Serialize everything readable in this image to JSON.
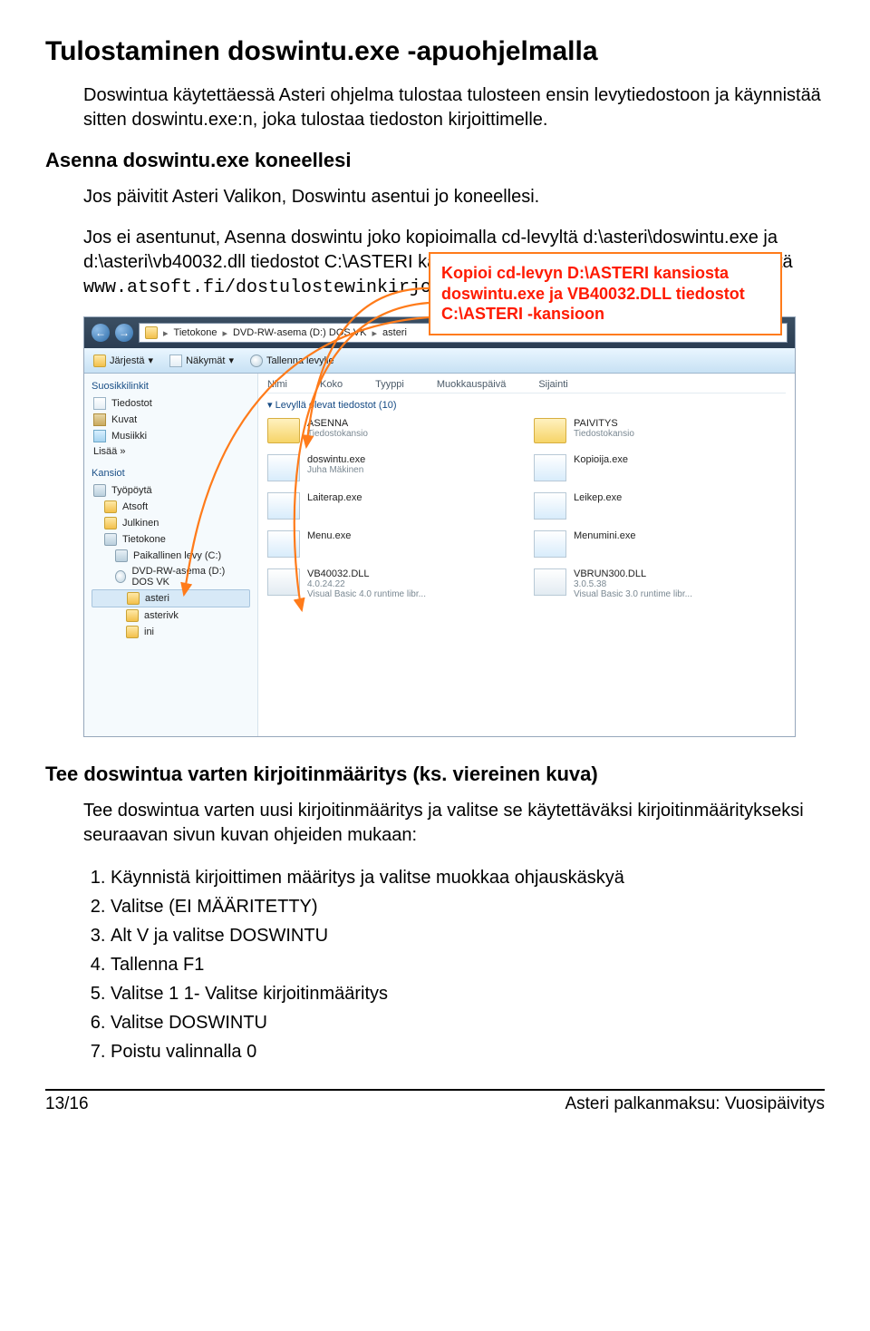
{
  "title": "Tulostaminen doswintu.exe -apuohjelmalla",
  "para1": "Doswintua käytettäessä Asteri ohjelma tulostaa tulosteen ensin levytiedostoon ja käynnistää sitten doswintu.exe:n, joka tulostaa tiedoston kirjoittimelle.",
  "h2": "Asenna doswintu.exe koneellesi",
  "para2": "Jos päivitit Asteri Valikon, Doswintu asentui jo koneellesi.",
  "para3a": "Jos ei asentunut, Asenna doswintu joko kopioimalla cd-levyltä d:\\asteri\\doswintu.exe ja d:\\asteri\\vb40032.dll tiedostot C:\\ASTERI kansioon tai tallenna vastaava tiedostot netistä ",
  "para3b": "www.atsoft.fi/dostulostewinkirjoittimelle.htm",
  "callout": "Kopioi cd-levyn D:\\ASTERI kansiosta doswintu.exe ja VB40032.DLL tiedostot C:\\ASTERI -kansioon",
  "breadcrumb": {
    "a": "Tietokone",
    "b": "DVD-RW-asema (D:) DOS VK",
    "c": "asteri"
  },
  "toolbar": {
    "a": "Järjestä",
    "b": "Näkymät",
    "c": "Tallenna levylle"
  },
  "sidebar": {
    "favhead": "Suosikkilinkit",
    "fav": [
      "Tiedostot",
      "Kuvat",
      "Musiikki",
      "Lisää »"
    ],
    "folhead": "Kansiot",
    "tree": {
      "desktop": "Työpöytä",
      "items": [
        "Atsoft",
        "Julkinen",
        "Tietokone"
      ],
      "sub": [
        "Paikallinen levy (C:)",
        "DVD-RW-asema (D:) DOS VK"
      ],
      "sel": "asteri",
      "more": [
        "asterivk",
        "ini"
      ]
    }
  },
  "cols": {
    "name": "Nimi",
    "size": "Koko",
    "type": "Tyyppi",
    "mod": "Muokkauspäivä",
    "loc": "Sijainti"
  },
  "group": "Levyllä olevat tiedostot (10)",
  "files": {
    "asenna": {
      "name": "ASENNA",
      "sub": "Tiedostokansio"
    },
    "paivitys": {
      "name": "PAIVITYS",
      "sub": "Tiedostokansio"
    },
    "doswintu": {
      "name": "doswintu.exe",
      "sub": "Juha Mäkinen"
    },
    "kopioija": {
      "name": "Kopioija.exe",
      "sub": ""
    },
    "laiterap": {
      "name": "Laiterap.exe",
      "sub": ""
    },
    "leikep": {
      "name": "Leikep.exe",
      "sub": ""
    },
    "menu": {
      "name": "Menu.exe",
      "sub": ""
    },
    "menumini": {
      "name": "Menumini.exe",
      "sub": ""
    },
    "vb40032": {
      "name": "VB40032.DLL",
      "sub1": "4.0.24.22",
      "sub2": "Visual Basic 4.0 runtime libr..."
    },
    "vbrun300": {
      "name": "VBRUN300.DLL",
      "sub1": "3.0.5.38",
      "sub2": "Visual Basic 3.0 runtime libr..."
    }
  },
  "h3a": "Tee doswintua varten kirjoitinmääritys (ks. viereinen kuva)",
  "para4": "Tee doswintua varten uusi kirjoitinmääritys ja valitse se käytettäväksi kirjoitinmääritykseksi seuraavan sivun kuvan ohjeiden mukaan:",
  "steps": [
    "Käynnistä kirjoittimen määritys ja valitse muokkaa ohjauskäskyä",
    "Valitse (EI MÄÄRITETTY)",
    "Alt V ja valitse DOSWINTU",
    "Tallenna F1",
    "Valitse 1 1- Valitse kirjoitinmääritys",
    "Valitse DOSWINTU",
    "Poistu valinnalla 0"
  ],
  "footer": {
    "left": "13/16",
    "right": "Asteri palkanmaksu: Vuosipäivitys"
  }
}
